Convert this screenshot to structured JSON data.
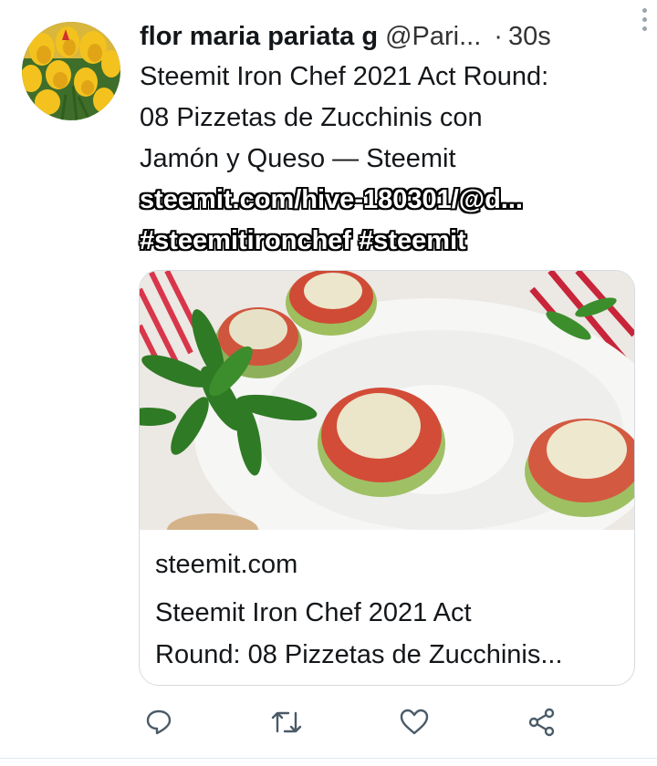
{
  "tweet": {
    "author_name": "flor maria pariata g",
    "handle": "@Pari...",
    "separator": "·",
    "time": "30s",
    "text_lines": [
      "Steemit Iron Chef 2021 Act Round:",
      "08 Pizzetas de Zucchinis con",
      "Jamón y Queso — Steemit"
    ],
    "link": "steemit.com/hive-180301/@d...",
    "hashtags": "#steemitironchef #steemit"
  },
  "card": {
    "image_icon": "food-photo",
    "domain": "steemit.com",
    "title_lines": [
      "Steemit Iron Chef 2021 Act",
      "Round: 08 Pizzetas de Zucchinis..."
    ]
  },
  "actions": {
    "icons": [
      "reply-icon",
      "retweet-icon",
      "like-icon",
      "share-icon"
    ]
  },
  "colors": {
    "icon": "#4a5a68",
    "divider": "#e1e8ed",
    "card_border": "#d6dbe0"
  }
}
